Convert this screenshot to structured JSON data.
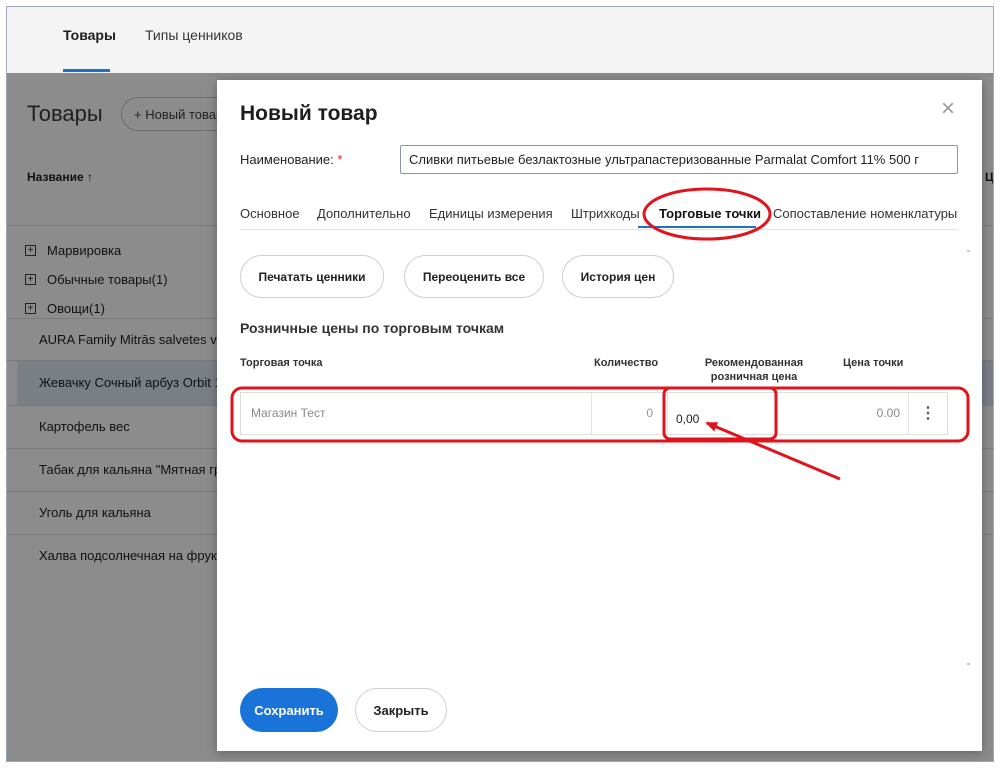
{
  "app": {
    "tabs": [
      {
        "label": "Товары",
        "active": true
      },
      {
        "label": "Типы ценников",
        "active": false
      }
    ]
  },
  "background": {
    "title": "Товары",
    "new_button": "+ Новый товар",
    "column_header": "Название ↑",
    "column_header_right": "Ц",
    "groups": [
      {
        "label": "Марвировка"
      },
      {
        "label": "Обычные товары(1)"
      },
      {
        "label": "Овощи(1)"
      }
    ],
    "rows": [
      {
        "label": "AURA Family Mitrās salvetes vi"
      },
      {
        "label": "Жевачку Сочный арбуз Orbit 1"
      },
      {
        "label": "Картофель вес"
      },
      {
        "label": "Табак для кальяна \"Мятная гр"
      },
      {
        "label": "Уголь для кальяна"
      },
      {
        "label": "Халва подсолнечная на фрукт"
      }
    ]
  },
  "modal": {
    "title": "Новый товар",
    "close_icon": "×",
    "name_label": "Наименование:",
    "required_mark": "*",
    "name_value": "Сливки питьевые безлактозные ультрапастеризованные Parmalat Comfort 11% 500 г",
    "tabs": [
      {
        "label": "Основное"
      },
      {
        "label": "Дополнительно"
      },
      {
        "label": "Единицы измерения"
      },
      {
        "label": "Штрихкоды"
      },
      {
        "label": "Торговые точки",
        "active": true
      },
      {
        "label": "Сопоставление номенклатуры"
      }
    ],
    "actions": {
      "print": "Печатать ценники",
      "reprice": "Переоценить все",
      "history": "История цен"
    },
    "section_title": "Розничные цены по торговым точкам",
    "table": {
      "headers": {
        "store": "Торговая точка",
        "qty": "Количество",
        "rec_line1": "Рекомендованная",
        "rec_line2": "розничная цена",
        "price": "Цена точки"
      },
      "rows": [
        {
          "store": "Магазин Тест",
          "qty": "0",
          "rec_price": "0,00",
          "price": "0.00",
          "more_icon": "⋮"
        }
      ]
    },
    "footer": {
      "save": "Сохранить",
      "close": "Закрыть"
    }
  },
  "annotations": {
    "color": "#e0141c",
    "icons": [
      "red-ellipse-tab",
      "red-row-rectangle",
      "red-cell-rectangle",
      "red-arrow"
    ]
  }
}
